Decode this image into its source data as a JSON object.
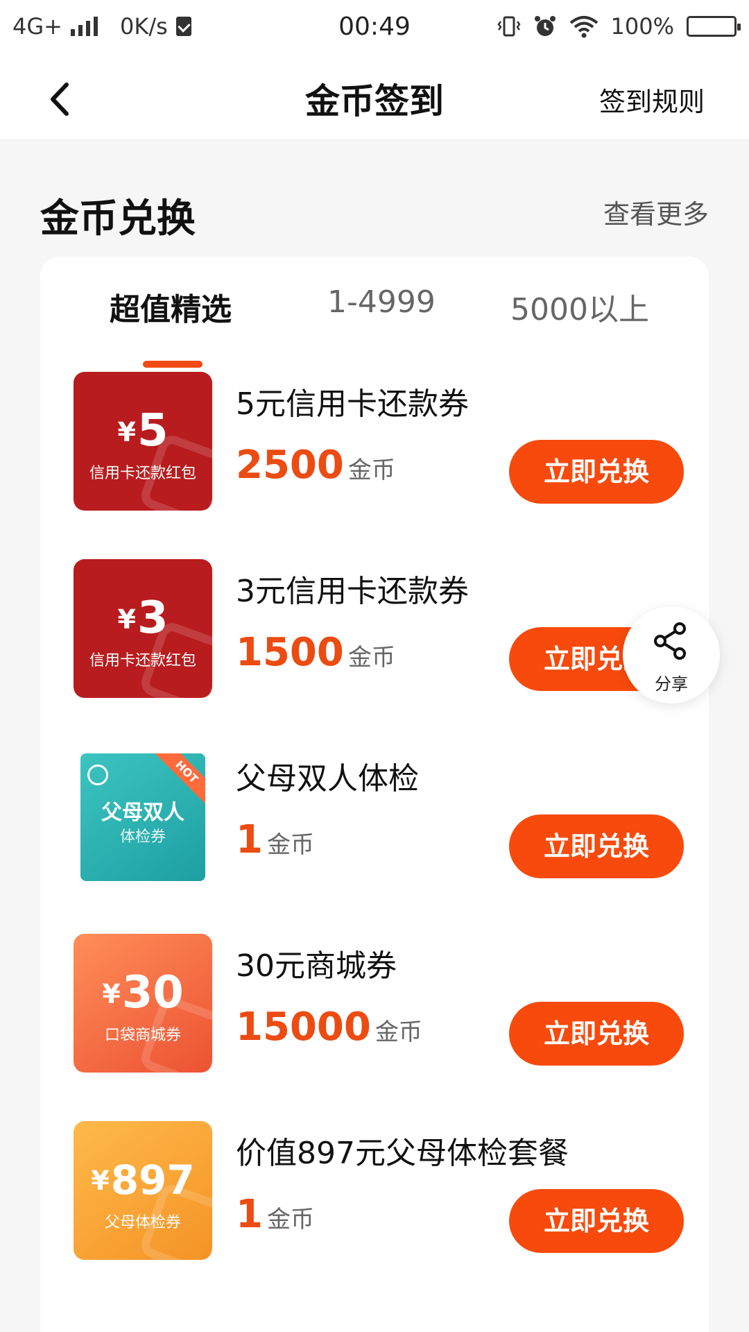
{
  "status_bar": {
    "network": "4G+",
    "speed": "0K/s",
    "time": "00:49",
    "battery": "100%"
  },
  "nav": {
    "title": "金币签到",
    "rules_label": "签到规则",
    "back_icon": "chevron-left-icon"
  },
  "section": {
    "title": "金币兑换",
    "see_more": "查看更多"
  },
  "tabs": [
    {
      "label": "超值精选",
      "active": true
    },
    {
      "label": "1-4999",
      "active": false
    },
    {
      "label": "5000以上",
      "active": false
    }
  ],
  "items": [
    {
      "title": "5元信用卡还款券",
      "price": "2500",
      "unit": "金币",
      "button": "立即兑换",
      "thumb": {
        "yen": "¥",
        "amount": "5",
        "sub": "信用卡还款红包",
        "color": "#b81c1e"
      }
    },
    {
      "title": "3元信用卡还款券",
      "price": "1500",
      "unit": "金币",
      "button": "立即兑换",
      "thumb": {
        "yen": "¥",
        "amount": "3",
        "sub": "信用卡还款红包",
        "color": "#b81c1e"
      }
    },
    {
      "title": "父母双人体检",
      "price": "1",
      "unit": "金币",
      "button": "立即兑换",
      "thumb": {
        "line1": "父母双人",
        "line2": "体检券",
        "ribbon": "HOT",
        "color": "#2bb3b2"
      }
    },
    {
      "title": "30元商城券",
      "price": "15000",
      "unit": "金币",
      "button": "立即兑换",
      "thumb": {
        "yen": "¥",
        "amount": "30",
        "sub": "口袋商城券",
        "color": "#f06a40"
      }
    },
    {
      "title": "价值897元父母体检套餐",
      "price": "1",
      "unit": "金币",
      "button": "立即兑换",
      "thumb": {
        "yen": "¥",
        "amount": "897",
        "sub": "父母体检券",
        "color": "#f7a337"
      }
    }
  ],
  "share": {
    "label": "分享",
    "icon": "share-icon"
  },
  "colors": {
    "accent": "#f74a0c",
    "price": "#ec4b12"
  }
}
